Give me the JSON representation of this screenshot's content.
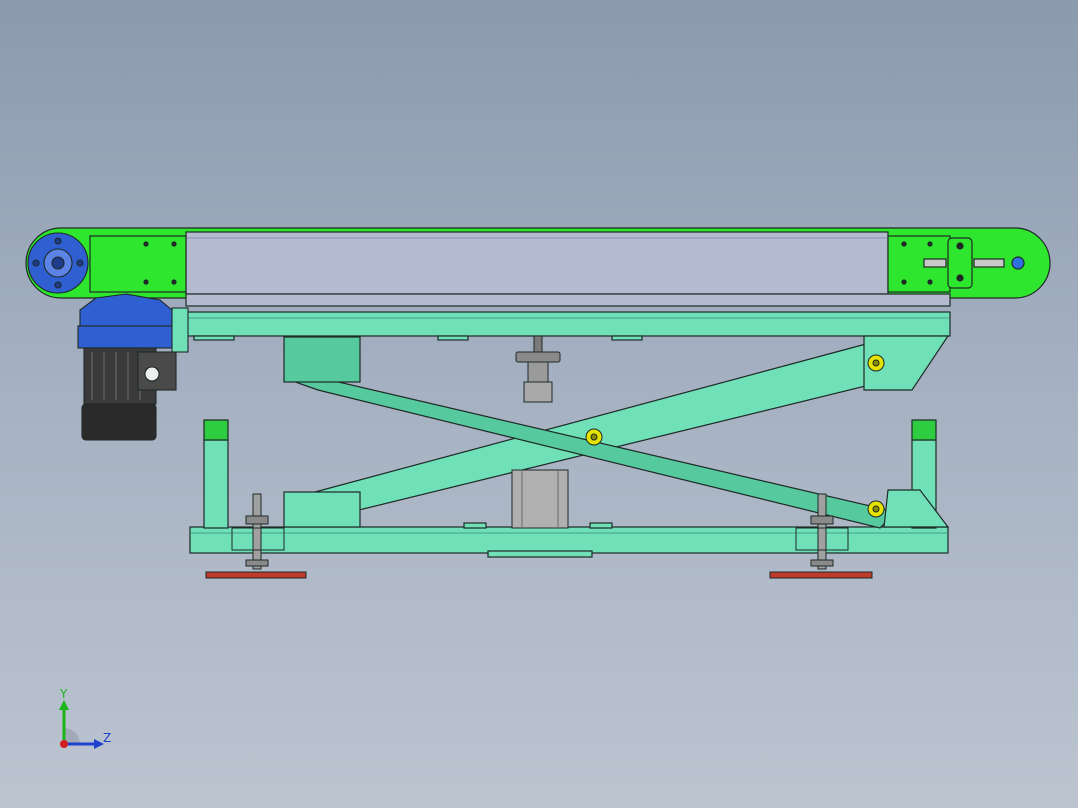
{
  "view": {
    "background_top": "#8b9aae",
    "background_bottom": "#bcc4d0"
  },
  "colors": {
    "frame": "#6fe0b8",
    "frame_dark": "#56c99f",
    "belt": "#b4bad0",
    "end_plate": "#2ee62e",
    "motor_blue": "#2f5fd0",
    "motor_body": "#3a3a3a",
    "foot_pad": "#c0392b",
    "pin": "#e4e400",
    "outline": "#1e2a26"
  },
  "icons": {
    "triad": "coordinate-triad-icon"
  },
  "triad": {
    "y_label": "Y",
    "z_label": "Z"
  }
}
